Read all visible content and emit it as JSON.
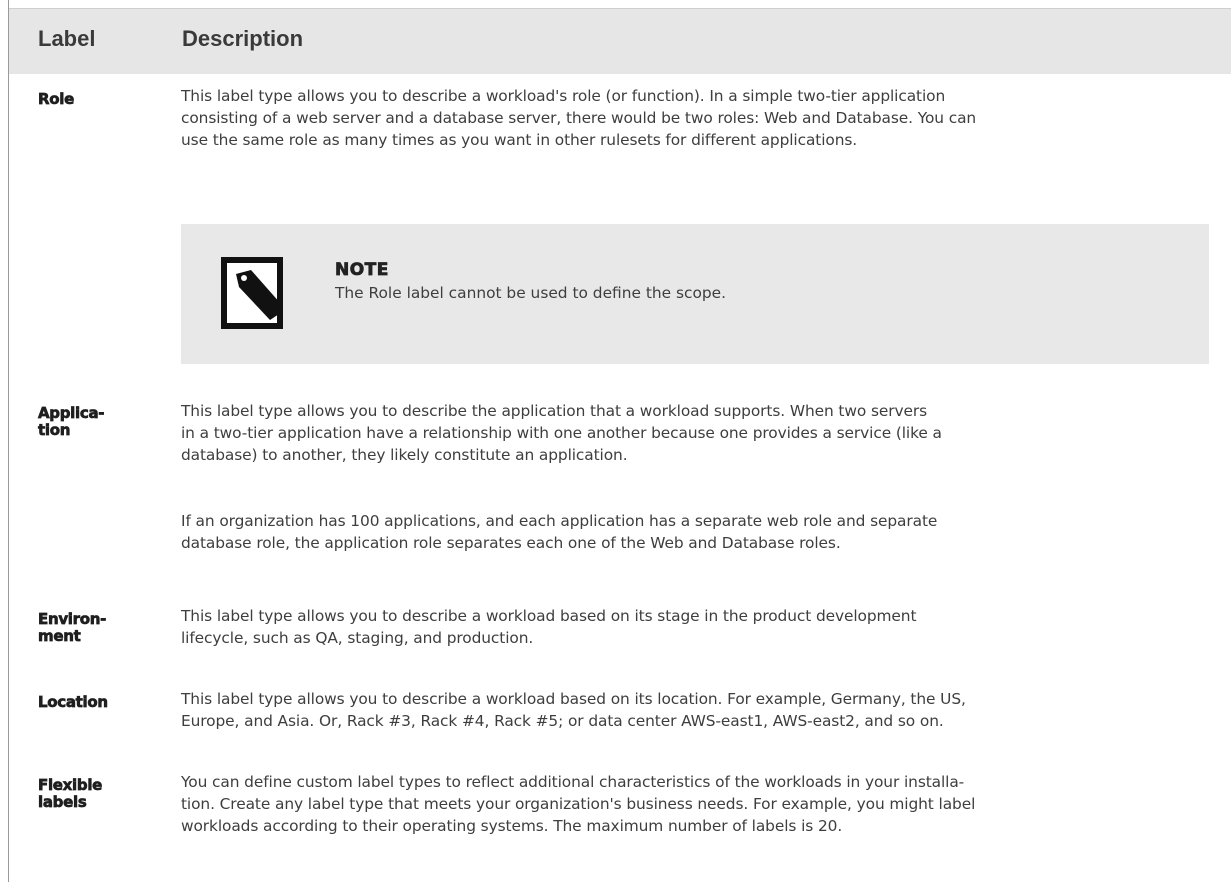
{
  "table": {
    "headers": {
      "label": "Label",
      "description": "Description"
    },
    "rows": [
      {
        "label_lines": [
          "Role"
        ],
        "paragraphs": [
          [
            "This label type allows you to describe a workload's role (or function). In a simple two-tier application",
            "consisting of a web server and a database server, there would be two roles: Web and Database. You can",
            "use the same role as many times as you want in other rulesets for different applications."
          ]
        ],
        "note": {
          "title": "NOTE",
          "text": "The Role label cannot be used to define the scope.",
          "icon": "note-tag-icon"
        }
      },
      {
        "label_lines": [
          "Applica-",
          "tion"
        ],
        "paragraphs": [
          [
            "This label type allows you to describe the application that a workload supports. When two servers",
            "in a two-tier application have a relationship with one another because one provides a service (like a",
            "database) to another, they likely constitute an application."
          ],
          [
            "If an organization has 100 applications, and each application has a separate web role and separate",
            "database role, the application role separates each one of the Web and Database roles."
          ]
        ]
      },
      {
        "label_lines": [
          "Environ-",
          "ment"
        ],
        "paragraphs": [
          [
            "This label type allows you to describe a workload based on its stage in the product development",
            "lifecycle, such as QA, staging, and production."
          ]
        ]
      },
      {
        "label_lines": [
          "Location"
        ],
        "paragraphs": [
          [
            "This label type allows you to describe a workload based on its location. For example, Germany, the US,",
            "Europe, and Asia. Or, Rack #3, Rack #4, Rack #5; or data center AWS-east1, AWS-east2, and so on."
          ]
        ]
      },
      {
        "label_lines": [
          "Flexible",
          "labels"
        ],
        "paragraphs": [
          [
            "You can define custom label types to reflect additional characteristics of the workloads in your installa-",
            "tion. Create any label type that meets your organization's business needs. For example, you might label",
            "workloads according to their operating systems. The maximum number of labels is 20."
          ]
        ]
      }
    ]
  }
}
